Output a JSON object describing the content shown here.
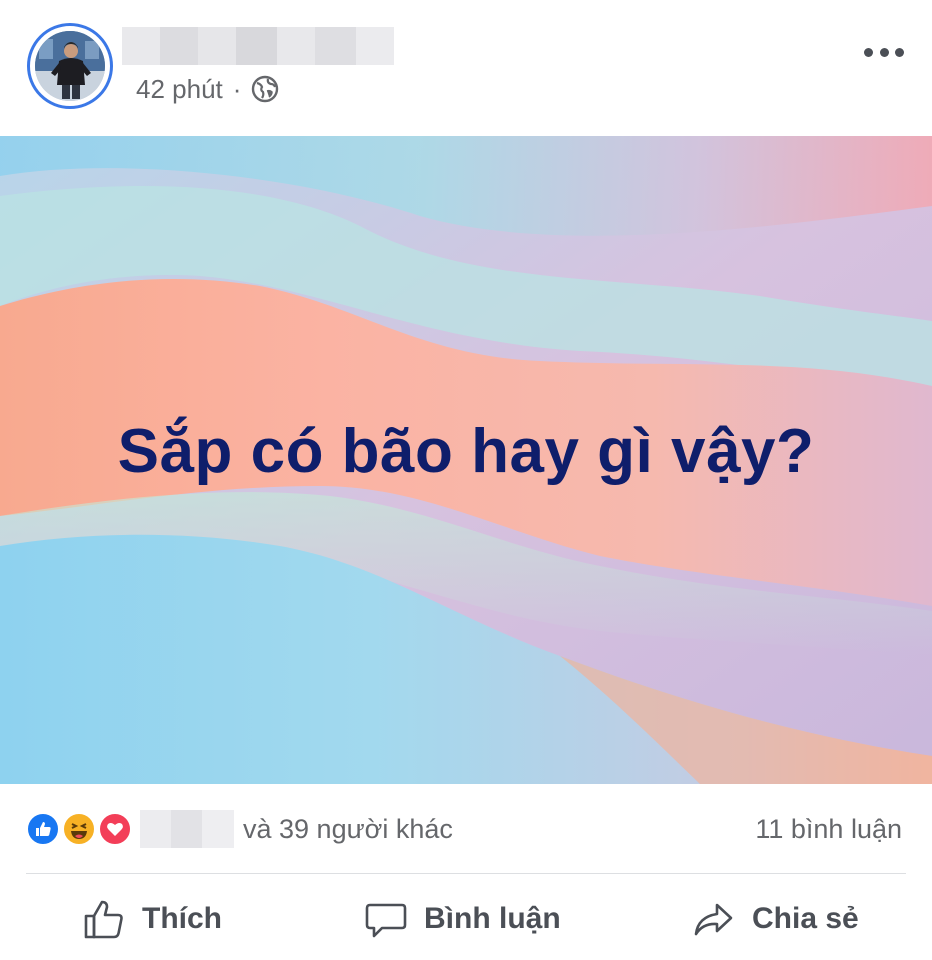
{
  "post": {
    "timestamp": "42 phút",
    "separator": "·",
    "privacy_icon": "globe-icon",
    "more_icon": "more-icon",
    "caption": "Sắp có bão hay gì vậy?",
    "colors": {
      "caption_text": "#0f1e6b",
      "avatar_ring": "#3b78e7",
      "meta_text": "#65676b",
      "action_text": "#4b4f56"
    }
  },
  "reactions": {
    "icons": [
      "like-icon",
      "haha-icon",
      "love-icon"
    ],
    "others_text": "và 39 người khác",
    "comments_text": "11 bình luận"
  },
  "actions": {
    "like_label": "Thích",
    "comment_label": "Bình luận",
    "share_label": "Chia sẻ"
  }
}
